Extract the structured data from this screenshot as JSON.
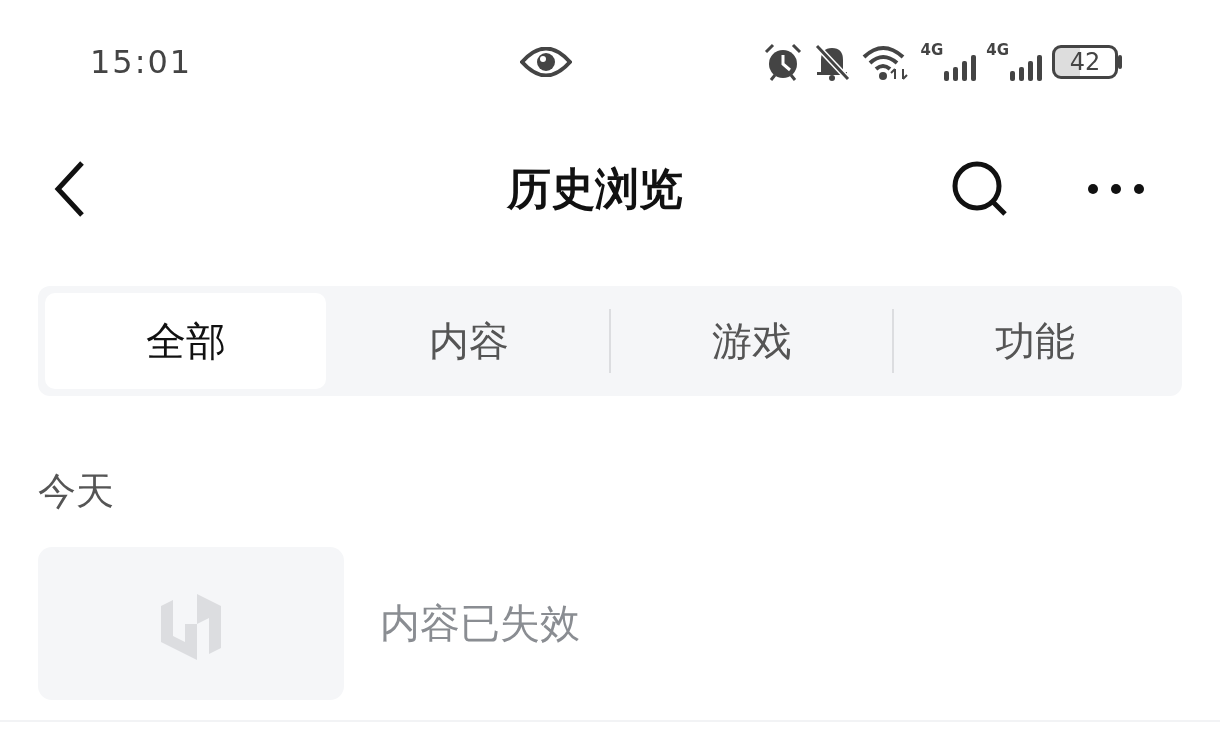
{
  "status_bar": {
    "time": "15:01",
    "network_1": "4G",
    "network_2": "4G",
    "battery": "42"
  },
  "nav_bar": {
    "title": "历史浏览"
  },
  "tabs": [
    {
      "label": "全部",
      "selected": true
    },
    {
      "label": "内容",
      "selected": false
    },
    {
      "label": "游戏",
      "selected": false
    },
    {
      "label": "功能",
      "selected": false
    }
  ],
  "sections": [
    {
      "heading": "今天",
      "items": [
        {
          "kind": "invalid",
          "text": "内容已失效"
        }
      ]
    }
  ]
}
